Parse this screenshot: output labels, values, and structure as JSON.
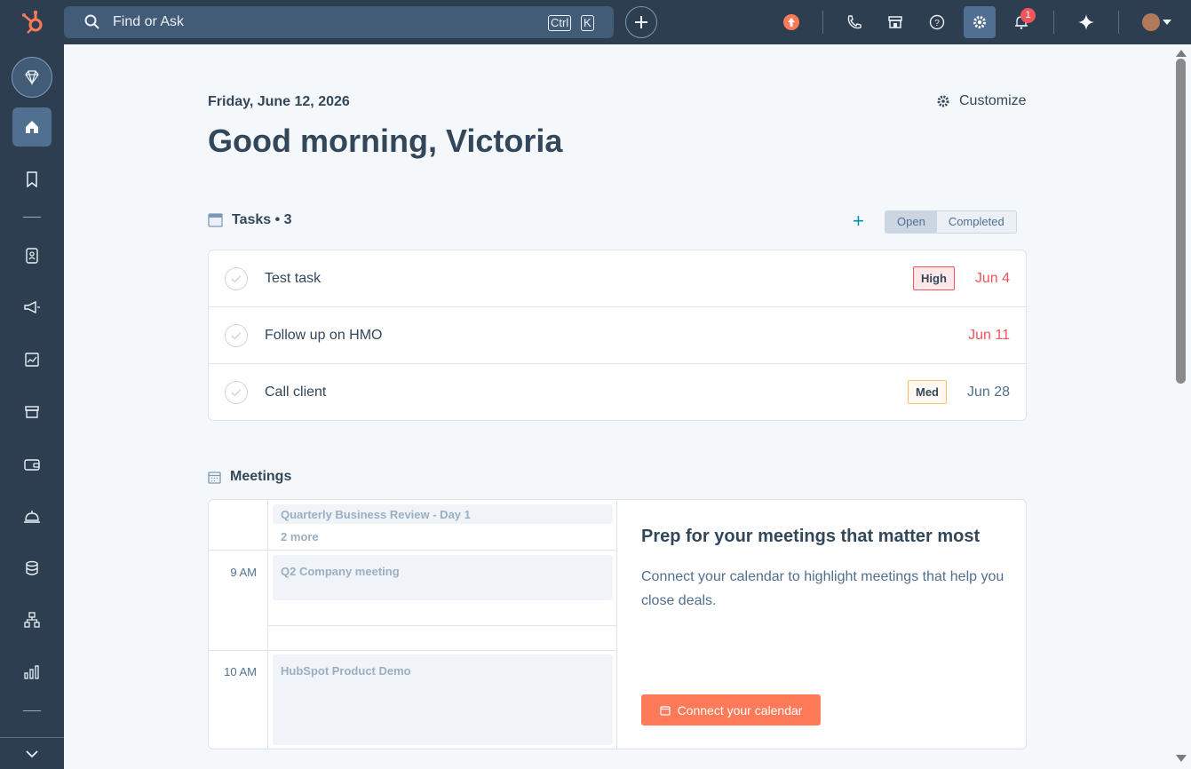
{
  "topbar": {
    "search_placeholder": "Find or Ask",
    "kbd_ctrl": "Ctrl",
    "kbd_k": "K",
    "notifications_count": "1",
    "icons": [
      "hubspot-logo",
      "search-icon",
      "plus-icon",
      "upgrade-icon",
      "phone-icon",
      "marketplace-icon",
      "help-icon",
      "settings-icon",
      "bell-icon",
      "ai-sparkle-icon",
      "avatar"
    ]
  },
  "sidebar": {
    "items": [
      "gem-icon",
      "home-icon",
      "bookmark-icon",
      "contacts-icon",
      "marketing-icon",
      "reports-icon",
      "sales-icon",
      "commerce-icon",
      "service-icon",
      "data-icon",
      "automation-icon",
      "reporting-icon",
      "collapse-icon"
    ]
  },
  "header": {
    "date": "Friday, June 12, 2026",
    "greeting": "Good morning, Victoria",
    "customize_label": "Customize"
  },
  "tasks": {
    "title": "Tasks • 3",
    "add_label": "+",
    "tab_open": "Open",
    "tab_completed": "Completed",
    "rows": [
      {
        "name": "Test task",
        "priority": "High",
        "due": "Jun 4"
      },
      {
        "name": "Follow up on HMO",
        "priority": "",
        "due": "Jun 11"
      },
      {
        "name": "Call client",
        "priority": "Med",
        "due": "Jun 28"
      }
    ]
  },
  "meetings": {
    "title": "Meetings",
    "allday_event": "Quarterly Business Review - Day 1",
    "more": "2 more",
    "slots": [
      {
        "time": "9 AM",
        "event": "Q2 Company meeting"
      },
      {
        "time": "10 AM",
        "event": "HubSpot Product Demo"
      }
    ],
    "prep_title": "Prep for your meetings that matter most",
    "prep_desc": "Connect your calendar to highlight meetings that help you close deals.",
    "connect_label": "Connect your calendar"
  },
  "colors": {
    "nav_bg": "#2d3e50",
    "accent_orange": "#ff7a59",
    "teal": "#0091ae",
    "overdue": "#f2545b"
  }
}
